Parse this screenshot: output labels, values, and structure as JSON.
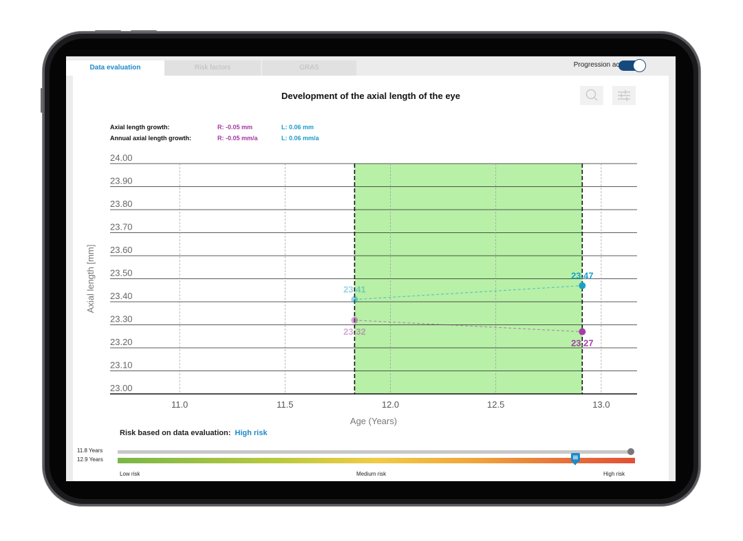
{
  "tabs": [
    {
      "label": "Data evaluation",
      "active": true
    },
    {
      "label": "Risk factors",
      "active": false
    },
    {
      "label": "GRAS",
      "active": false
    }
  ],
  "toggle": {
    "label": "Progression active",
    "on": true
  },
  "tools": {
    "search_icon": "magnifier",
    "filter_icon": "sliders"
  },
  "stats": {
    "growth_label": "Axial length growth:",
    "growth_r": "R: -0.05 mm",
    "growth_l": "L: 0.06 mm",
    "annual_label": "Annual axial length growth:",
    "annual_r": "R: -0.05 mm/a",
    "annual_l": "L: 0.06 mm/a"
  },
  "chart_data": {
    "type": "line",
    "title": "Development of the axial length of the eye",
    "xlabel": "Age (Years)",
    "ylabel": "Axial length [mm]",
    "xlim": [
      10.67,
      13.17
    ],
    "ylim": [
      23.0,
      24.0
    ],
    "x_ticks": [
      "11.0",
      "11.5",
      "12.0",
      "12.5",
      "13.0"
    ],
    "y_ticks": [
      "24.00",
      "23.90",
      "23.80",
      "23.70",
      "23.60",
      "23.50",
      "23.40",
      "23.30",
      "23.20",
      "23.10",
      "23.00"
    ],
    "highlight_range": [
      11.83,
      12.91
    ],
    "highlight_color": "#b8f0a8",
    "series": [
      {
        "eye": "L",
        "color": "#1aa0c8",
        "x": [
          11.83,
          12.91
        ],
        "y": [
          23.41,
          23.47
        ],
        "labels": [
          "23.41",
          "23.47"
        ]
      },
      {
        "eye": "R",
        "color": "#a73ea6",
        "x": [
          11.83,
          12.91
        ],
        "y": [
          23.32,
          23.27
        ],
        "labels": [
          "23.32",
          "23.27"
        ]
      }
    ],
    "grid": true
  },
  "risk": {
    "label": "Risk based on data evaluation:",
    "value": "High risk",
    "bar_top_label": "11.8 Years",
    "bar_bottom_label": "12.9 Years",
    "marker_level": 0.885,
    "scale": [
      "Low risk",
      "Medium risk",
      "High risk"
    ]
  },
  "colors": {
    "accent": "#1d8ac8",
    "right_eye": "#a437a3",
    "left_eye": "#1a9bc9",
    "toggle": "#174a7c"
  }
}
